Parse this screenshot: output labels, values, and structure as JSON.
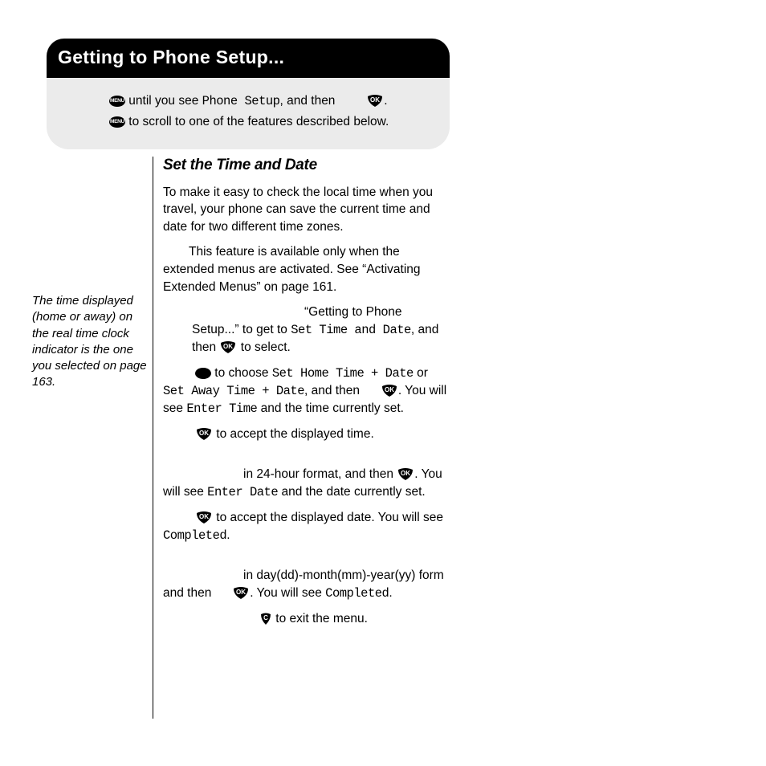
{
  "header": {
    "title": "Getting to Phone Setup...",
    "line1_a": " until you see ",
    "line1_display": "Phone Setup",
    "line1_b": ", and then ",
    "line1_c": ".",
    "line2_a": " to scroll to one of the features described below."
  },
  "margin_note": "The time displayed (home or away) on the real time clock indicator is the one you selected on page 163.",
  "section": {
    "title": "Set the Time and Date",
    "intro": "To make it easy to check the local time when you travel, your phone can save the current time and date for two different time zones.",
    "note": "This feature is available only when the extended menus are activated. See “Activating Extended Menus” on page 161.",
    "step1_a": "“Getting to Phone Setup...” to get to ",
    "step1_disp": "Set Time and Date",
    "step1_b": ", and then ",
    "step1_c": " to select.",
    "step2_a": " to choose ",
    "step2_disp1": "Set Home Time + Date",
    "step2_mid": " or ",
    "step2_disp2": "Set Away Time + Date",
    "step2_b": ", and then ",
    "step2_c": ". You will see ",
    "step2_disp3": "Enter Time",
    "step2_d": " and the time currently set.",
    "step3_a": " to accept the displayed time.",
    "step4_a": "in 24-hour format, and then ",
    "step4_b": ". You will see ",
    "step4_disp": "Enter Date",
    "step4_c": " and the date currently set.",
    "step5_a": " to accept the displayed date. You will see ",
    "step5_disp": "Completed",
    "step5_b": ".",
    "step6_a": "in day(dd)-month(mm)-year(yy) form and then ",
    "step6_b": ". You will see ",
    "step6_disp": "Completed",
    "step6_c": ".",
    "step7_a": " to exit the menu."
  }
}
